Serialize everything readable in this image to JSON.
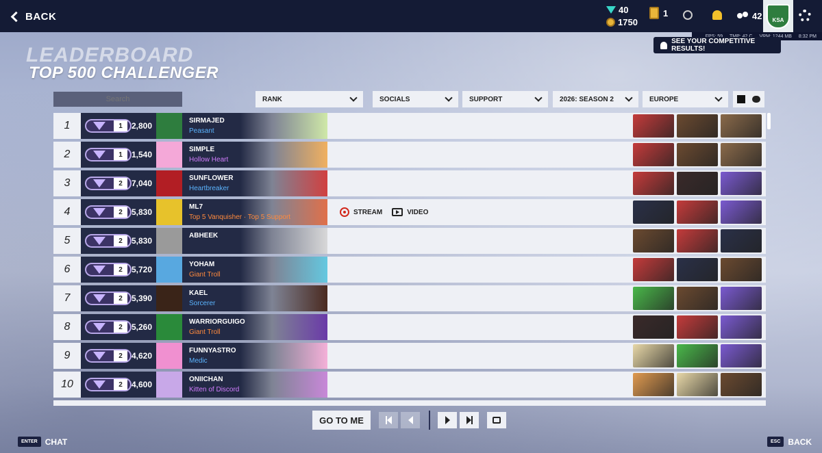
{
  "topbar": {
    "back_label": "BACK",
    "credits_a": "40",
    "credits_b": "1750",
    "lootboxes": "1",
    "friends": "42",
    "profile_badge": "KSA"
  },
  "subbar": {
    "fps": "FPS: 59",
    "tmp": "TMP: 42 C",
    "vram": "VRM: 1244 MB",
    "time": "8:32 PM"
  },
  "results_button": "SEE YOUR COMPETITIVE RESULTS!",
  "title": {
    "line1": "LEADERBOARD",
    "line2": "TOP 500 CHALLENGER"
  },
  "search_placeholder": "Search",
  "filters": {
    "rank": "RANK",
    "socials": "SOCIALS",
    "role": "SUPPORT",
    "season": "2026: SEASON 2",
    "region": "EUROPE"
  },
  "rows": [
    {
      "rank": "1",
      "tier": "1",
      "score": "2,800",
      "name": "SIRMAJED",
      "title": "Peasant",
      "title_color": "blue",
      "streams": false,
      "pic": "#2e7d3e",
      "banner": "#cfe8a8",
      "heroes": [
        "#c43b3b",
        "#6b4a30",
        "#8a6a4a"
      ]
    },
    {
      "rank": "2",
      "tier": "1",
      "score": "1,540",
      "name": "SIMPLE",
      "title": "Hollow Heart",
      "title_color": "purple",
      "streams": false,
      "pic": "#f4a8d8",
      "banner": "#f0b060",
      "heroes": [
        "#c43b3b",
        "#6b4a30",
        "#8a6a4a"
      ]
    },
    {
      "rank": "3",
      "tier": "2",
      "score": "7,040",
      "name": "SUNFLOWER",
      "title": "Heartbreaker",
      "title_color": "blue",
      "streams": false,
      "pic": "#b21e24",
      "banner": "#d14040",
      "heroes": [
        "#c43b3b",
        "#3a2a2a",
        "#7a5ad0"
      ]
    },
    {
      "rank": "4",
      "tier": "2",
      "score": "5,830",
      "name": "ML7",
      "title": "Top 5 Vanquisher · Top 5 Support",
      "title_color": "orange",
      "streams": true,
      "pic": "#e7c22b",
      "banner": "#e0704a",
      "heroes": [
        "#2a3048",
        "#c43b3b",
        "#7a5ad0"
      ]
    },
    {
      "rank": "5",
      "tier": "2",
      "score": "5,830",
      "name": "ABHEEK",
      "title": "",
      "title_color": "blue",
      "streams": false,
      "pic": "#9a9a9a",
      "banner": "#d8d8d8",
      "heroes": [
        "#6b4a30",
        "#c43b3b",
        "#2a3048"
      ]
    },
    {
      "rank": "6",
      "tier": "2",
      "score": "5,720",
      "name": "YOHAM",
      "title": "Giant Troll",
      "title_color": "orange",
      "streams": false,
      "pic": "#58a8e0",
      "banner": "#64c8e0",
      "heroes": [
        "#c43b3b",
        "#2a3048",
        "#6b4a30"
      ]
    },
    {
      "rank": "7",
      "tier": "2",
      "score": "5,390",
      "name": "KAEL",
      "title": "Sorcerer",
      "title_color": "blue",
      "streams": false,
      "pic": "#3a2418",
      "banner": "#4a2a20",
      "heroes": [
        "#4ab84a",
        "#6b4a30",
        "#7a5ad0"
      ]
    },
    {
      "rank": "8",
      "tier": "2",
      "score": "5,260",
      "name": "WARRIORGUIGO",
      "title": "Giant Troll",
      "title_color": "orange",
      "streams": false,
      "pic": "#2a8a3a",
      "banner": "#6a3aa8",
      "heroes": [
        "#3a2a2a",
        "#c43b3b",
        "#7a5ad0"
      ]
    },
    {
      "rank": "9",
      "tier": "2",
      "score": "4,620",
      "name": "FUNNYASTRO",
      "title": "Medic",
      "title_color": "blue",
      "streams": false,
      "pic": "#f090d0",
      "banner": "#f4b0d8",
      "heroes": [
        "#e8d8a8",
        "#4ab84a",
        "#7a5ad0"
      ]
    },
    {
      "rank": "10",
      "tier": "2",
      "score": "4,600",
      "name": "ONIICHAN",
      "title": "Kitten of Discord",
      "title_color": "purple",
      "streams": false,
      "pic": "#c8a8e8",
      "banner": "#c888d8",
      "heroes": [
        "#e09a50",
        "#e8d8a8",
        "#6b4a30"
      ]
    }
  ],
  "stream_label": "STREAM",
  "video_label": "VIDEO",
  "pagination": {
    "goto_label": "GO TO ME"
  },
  "hints": {
    "enter_key": "ENTER",
    "enter_label": "CHAT",
    "esc_key": "ESC",
    "esc_label": "BACK"
  }
}
